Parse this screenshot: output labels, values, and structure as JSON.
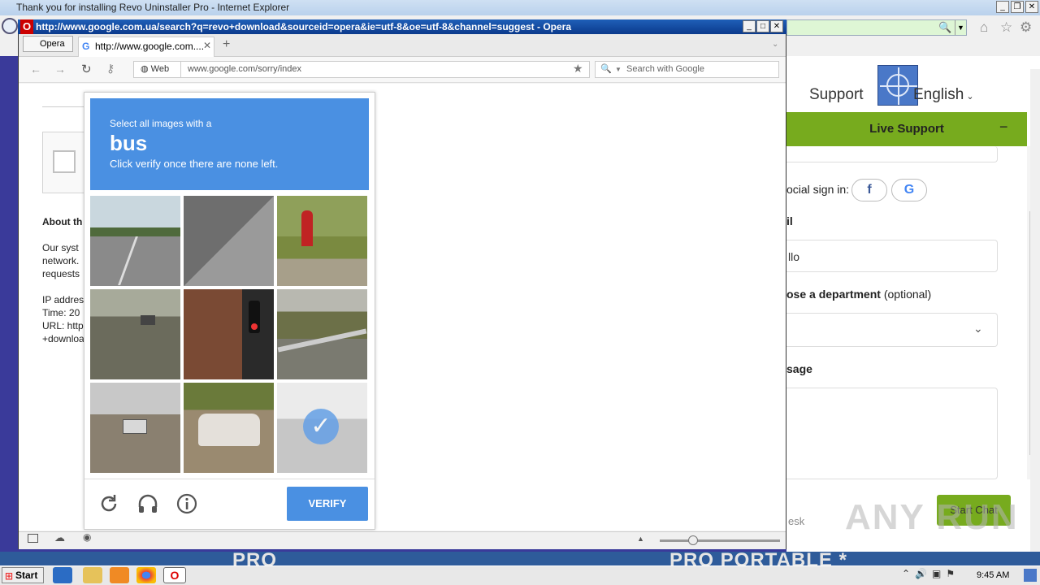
{
  "ie": {
    "title": "Thank you for installing Revo Uninstaller Pro - Internet Explorer",
    "nav_support": "Support",
    "nav_language": "English",
    "live_support": {
      "header": "Live Support",
      "social_label": "ocial sign in:",
      "email_label": "il",
      "email_value": "llo",
      "dept_label_bold": "ose a department",
      "dept_label_opt": "(optional)",
      "message_label": "sage",
      "start_chat": "Start Chat",
      "footer": "esk"
    },
    "banner_left": "PRO",
    "banner_right": "PRO PORTABLE *"
  },
  "opera": {
    "title": "http://www.google.com.ua/search?q=revo+download&sourceid=opera&ie=utf-8&oe=utf-8&channel=suggest - Opera",
    "menu_button": "Opera",
    "tab_title": "http://www.google.com....",
    "url_label": "Web",
    "url": "www.google.com/sorry/index",
    "search_placeholder": "Search with Google"
  },
  "page": {
    "about": "About th",
    "line1": "Our syst",
    "line2": "network.",
    "line3": "requests",
    "ip": "IP addres",
    "time": "Time: 20",
    "url_line": "URL: http",
    "download": "+downloa"
  },
  "captcha": {
    "select_text": "Select all images with a",
    "target": "bus",
    "instruction": "Click verify once there are none left.",
    "verify": "VERIFY",
    "tiles": [
      {
        "scene": "road-palms",
        "selected": false
      },
      {
        "scene": "asphalt-shadow",
        "selected": false
      },
      {
        "scene": "fire-hydrant",
        "selected": false
      },
      {
        "scene": "road-car",
        "selected": false
      },
      {
        "scene": "traffic-light",
        "selected": false
      },
      {
        "scene": "bridge-rail",
        "selected": false
      },
      {
        "scene": "parking-lot",
        "selected": false
      },
      {
        "scene": "white-car",
        "selected": false
      },
      {
        "scene": "street-bus",
        "selected": true
      }
    ]
  },
  "taskbar": {
    "start": "Start",
    "clock": "9:45 AM"
  },
  "watermark": "ANY RUN"
}
